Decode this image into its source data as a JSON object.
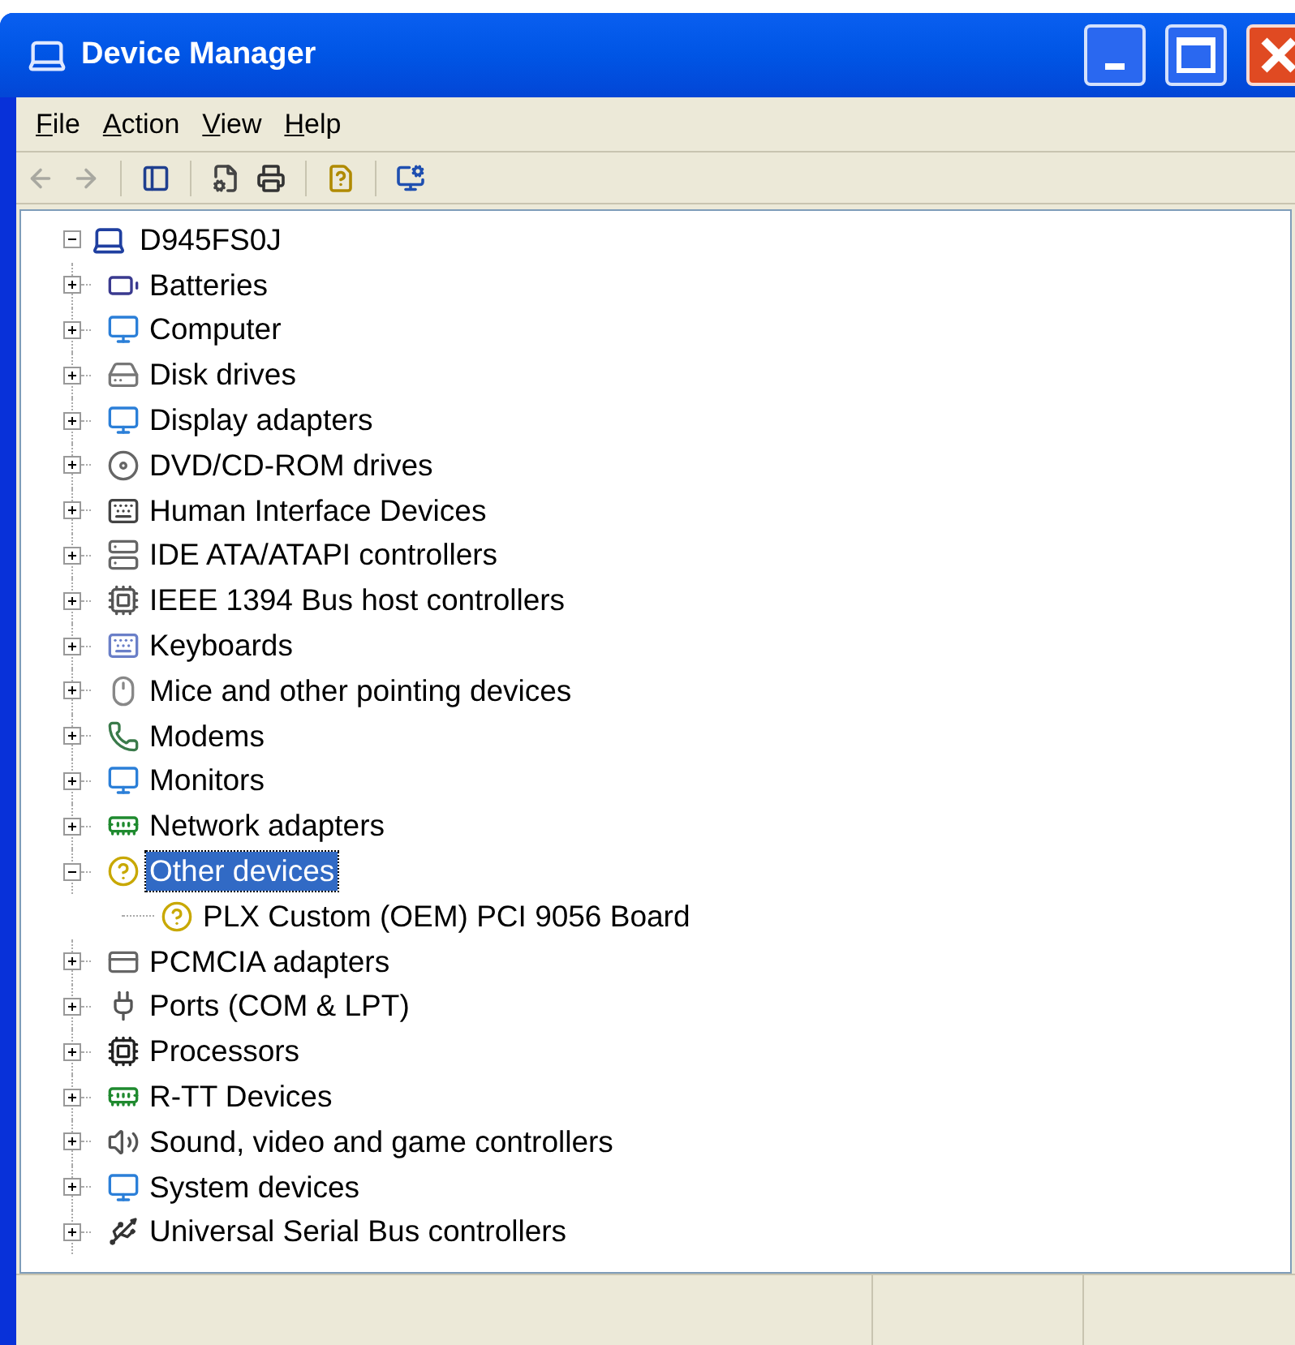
{
  "window": {
    "title": "Device Manager"
  },
  "menu": [
    "File",
    "Action",
    "View",
    "Help"
  ],
  "toolbar": {
    "buttons": [
      {
        "disabled": true
      },
      {
        "disabled": true
      },
      {
        "disabled": false
      },
      {
        "disabled": false
      },
      {
        "disabled": false
      },
      {
        "disabled": false
      },
      {
        "disabled": false
      }
    ]
  },
  "tree": {
    "label": "D945FS0J",
    "expanded": true,
    "children": [
      {
        "label": "Batteries",
        "expanded": false,
        "selected": false
      },
      {
        "label": "Computer",
        "expanded": false,
        "selected": false
      },
      {
        "label": "Disk drives",
        "expanded": false,
        "selected": false
      },
      {
        "label": "Display adapters",
        "expanded": false,
        "selected": false
      },
      {
        "label": "DVD/CD-ROM drives",
        "expanded": false,
        "selected": false
      },
      {
        "label": "Human Interface Devices",
        "expanded": false,
        "selected": false
      },
      {
        "label": "IDE ATA/ATAPI controllers",
        "expanded": false,
        "selected": false
      },
      {
        "label": "IEEE 1394 Bus host controllers",
        "expanded": false,
        "selected": false
      },
      {
        "label": "Keyboards",
        "expanded": false,
        "selected": false
      },
      {
        "label": "Mice and other pointing devices",
        "expanded": false,
        "selected": false
      },
      {
        "label": "Modems",
        "expanded": false,
        "selected": false
      },
      {
        "label": "Monitors",
        "expanded": false,
        "selected": false
      },
      {
        "label": "Network adapters",
        "expanded": false,
        "selected": false
      },
      {
        "label": "Other devices",
        "expanded": true,
        "selected": true,
        "children": [
          {
            "label": "PLX Custom (OEM) PCI 9056 Board",
            "selected": false
          }
        ]
      },
      {
        "label": "PCMCIA adapters",
        "expanded": false,
        "selected": false
      },
      {
        "label": "Ports (COM & LPT)",
        "expanded": false,
        "selected": false
      },
      {
        "label": "Processors",
        "expanded": false,
        "selected": false
      },
      {
        "label": "R-TT Devices",
        "expanded": false,
        "selected": false
      },
      {
        "label": "Sound, video and game controllers",
        "expanded": false,
        "selected": false
      },
      {
        "label": "System devices",
        "expanded": false,
        "selected": false
      },
      {
        "label": "Universal Serial Bus controllers",
        "expanded": false,
        "selected": false
      }
    ]
  }
}
